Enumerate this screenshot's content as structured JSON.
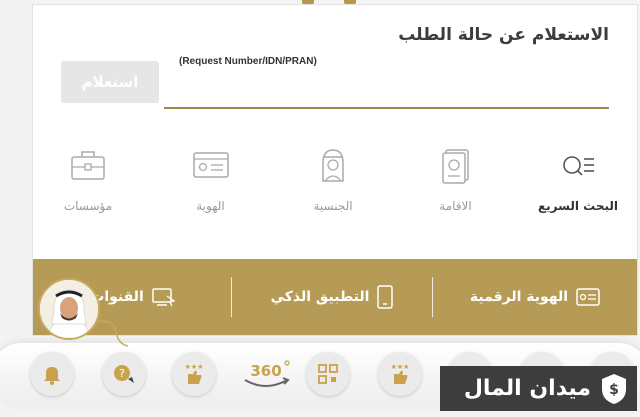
{
  "form": {
    "title": "الاستعلام عن حالة الطلب",
    "input_label": "(Request Number/IDN/PRAN)",
    "input_value": "",
    "submit_label": "استعلام"
  },
  "services": [
    {
      "label": "البحث السريع",
      "icon": "quick-search-icon",
      "active": true
    },
    {
      "label": "الاقامة",
      "icon": "passport-icon",
      "active": false
    },
    {
      "label": "الجنسية",
      "icon": "nationality-person-icon",
      "active": false
    },
    {
      "label": "الهوية",
      "icon": "id-card-icon",
      "active": false
    },
    {
      "label": "مؤسسات",
      "icon": "briefcase-icon",
      "active": false
    }
  ],
  "bar": [
    {
      "label": "الهوية الرقمية",
      "icon": "digital-id-icon"
    },
    {
      "label": "التطبيق الذكي",
      "icon": "smartphone-icon"
    },
    {
      "label": "القنوات",
      "icon": "channels-icon"
    }
  ],
  "dock": {
    "icons": [
      "bell-icon",
      "help-chat-icon",
      "rating-thumb-icon",
      "360-view-icon",
      "qr-code-icon",
      "rating-thumb-icon",
      "circle-icon",
      "card-icon",
      "feature-icon"
    ],
    "badge_360": "360"
  },
  "watermark": {
    "text": "ميدان المال",
    "icon": "money-shield-icon"
  },
  "colors": {
    "gold": "#b59b55",
    "gold_dark": "#a4884a",
    "text": "#3c3c3c",
    "muted": "#9a9a9a"
  }
}
